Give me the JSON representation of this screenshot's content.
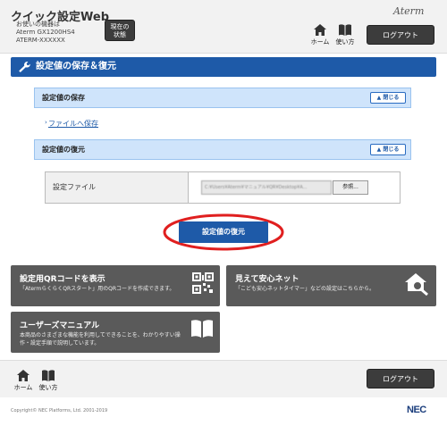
{
  "header": {
    "app_title": "クイック設定Web",
    "device_label": "お使いの機器は",
    "model": "Aterm GX1200HS4",
    "ssid": "ATERM-XXXXXX",
    "status_button": [
      "現在の",
      "状態"
    ],
    "brand": "Aterm",
    "nav": {
      "home_label": "ホーム",
      "help_label": "使い方"
    },
    "logout_label": "ログアウト"
  },
  "section": {
    "title": "設定値の保存＆復元"
  },
  "save_panel": {
    "title": "設定値の保存",
    "close_label": "閉じる",
    "link_label": "ファイルへ保存"
  },
  "restore_panel": {
    "title": "設定値の復元",
    "close_label": "閉じる",
    "file_label": "設定ファイル",
    "file_path": "C:¥Users¥Aterm¥マニュアル¥QR¥Desktop¥A...",
    "browse_label": "参照...",
    "restore_button": "設定値の復元"
  },
  "cards": {
    "qr": {
      "title": "設定用QRコードを表示",
      "desc": "「AtermらくらくQRスタート」用のQRコードを作成できます。"
    },
    "anshin": {
      "title": "見えて安心ネット",
      "desc": "「こども安心ネットタイマー」などの設定はこちらから。"
    },
    "manual": {
      "title": "ユーザーズマニュアル",
      "desc": [
        "本商品のさまざまな機能を利用してできることを、わかりやすい操",
        "作・設定手順で説明しています。"
      ]
    }
  },
  "footer": {
    "home_label": "ホーム",
    "help_label": "使い方",
    "logout_label": "ログアウト",
    "copyright": "Copyright© NEC Platforms, Ltd. 2001-2019",
    "logo": "NEC"
  },
  "colors": {
    "accent": "#1e5aa8",
    "panel": "#cfe4fb",
    "card": "#5a5a5a",
    "highlight": "#e01f1f"
  }
}
